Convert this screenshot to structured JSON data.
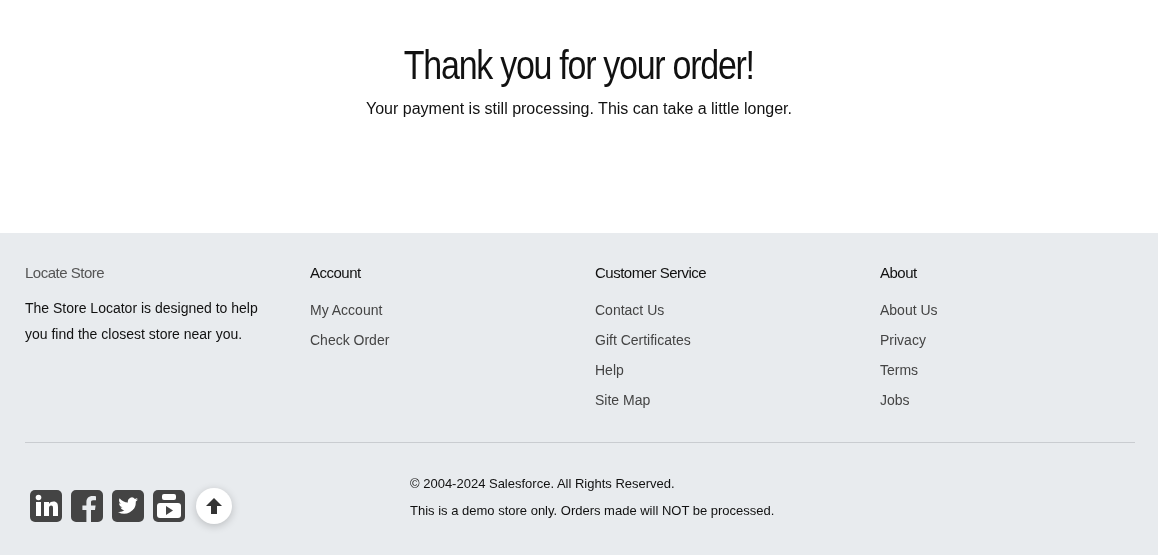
{
  "confirmation": {
    "title": "Thank you for your order!",
    "message": "Your payment is still processing. This can take a little longer."
  },
  "footer": {
    "columns": [
      {
        "heading": "Locate Store",
        "kind": "text",
        "text": "The Store Locator is designed to help you find the closest store near you."
      },
      {
        "heading": "Account",
        "kind": "links",
        "links": [
          "My Account",
          "Check Order"
        ]
      },
      {
        "heading": "Customer Service",
        "kind": "links",
        "links": [
          "Contact Us",
          "Gift Certificates",
          "Help",
          "Site Map"
        ]
      },
      {
        "heading": "About",
        "kind": "links",
        "links": [
          "About Us",
          "Privacy",
          "Terms",
          "Jobs"
        ]
      }
    ],
    "social": [
      {
        "kind": "linkedin"
      },
      {
        "kind": "facebook"
      },
      {
        "kind": "twitter"
      },
      {
        "kind": "youtube"
      }
    ],
    "copyright": "© 2004-2024 Salesforce. All Rights Reserved.",
    "notice": "This is a demo store only. Orders made will NOT be processed."
  }
}
